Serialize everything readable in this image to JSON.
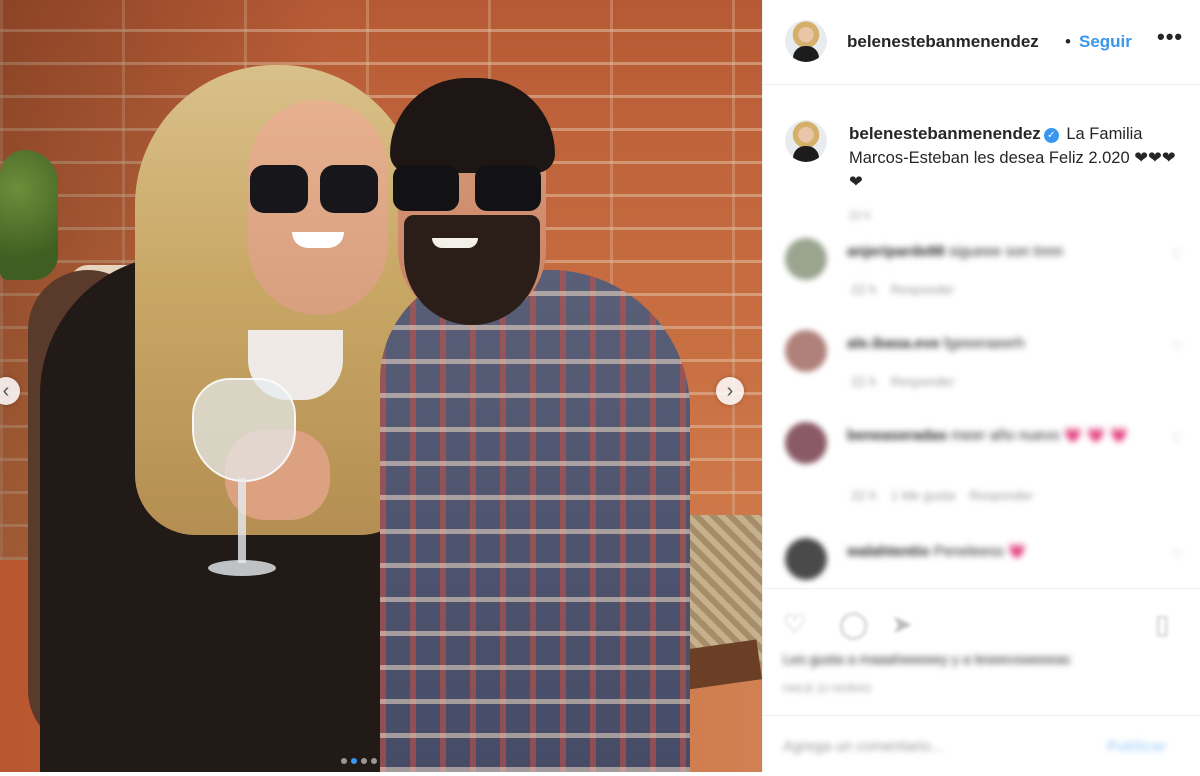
{
  "header": {
    "username": "belenestebanmenendez",
    "separator": "•",
    "follow_label": "Seguir",
    "more_label": "•••"
  },
  "photo": {
    "prev_label": "‹",
    "next_label": "›",
    "carousel_count": 4,
    "carousel_active": 2
  },
  "caption": {
    "username": "belenestebanmenendez",
    "verified_glyph": "✓",
    "text": "La Familia Marcos-Esteban les desea Feliz 2.020 ❤❤❤❤",
    "time": "22 h"
  },
  "comments": [
    {
      "username": "anjeriparde88",
      "text": "sigueee son tnnn",
      "time": "22 h",
      "reply_label": "Responder",
      "likes_label": ""
    },
    {
      "username": "ale.ibasa.eve",
      "text": "fgeeeraeerh",
      "time": "22 h",
      "reply_label": "Responder",
      "likes_label": ""
    },
    {
      "username": "beneaseradas",
      "text": "meer año nuevo 💗 💗 💗",
      "time": "22 h",
      "reply_label": "Responder",
      "likes_label": "1 Me gusta"
    },
    {
      "username": "walahtentio",
      "text": "Peneleess 💗",
      "time": "",
      "reply_label": "",
      "likes_label": ""
    }
  ],
  "actions": {
    "like_icon": "heart-outline",
    "comment_icon": "comment-bubble",
    "share_icon": "paper-plane",
    "save_icon": "bookmark",
    "likes_text": "Les gusta a maaaheeeeey y a leseevsweeeas",
    "ago_text": "HACE 22 HORAS"
  },
  "add_comment": {
    "placeholder": "Agrega un comentario...",
    "post_label": "Publicar"
  },
  "colors": {
    "accent": "#3897f0",
    "text": "#262626",
    "muted": "#999999",
    "border": "#efefef"
  }
}
